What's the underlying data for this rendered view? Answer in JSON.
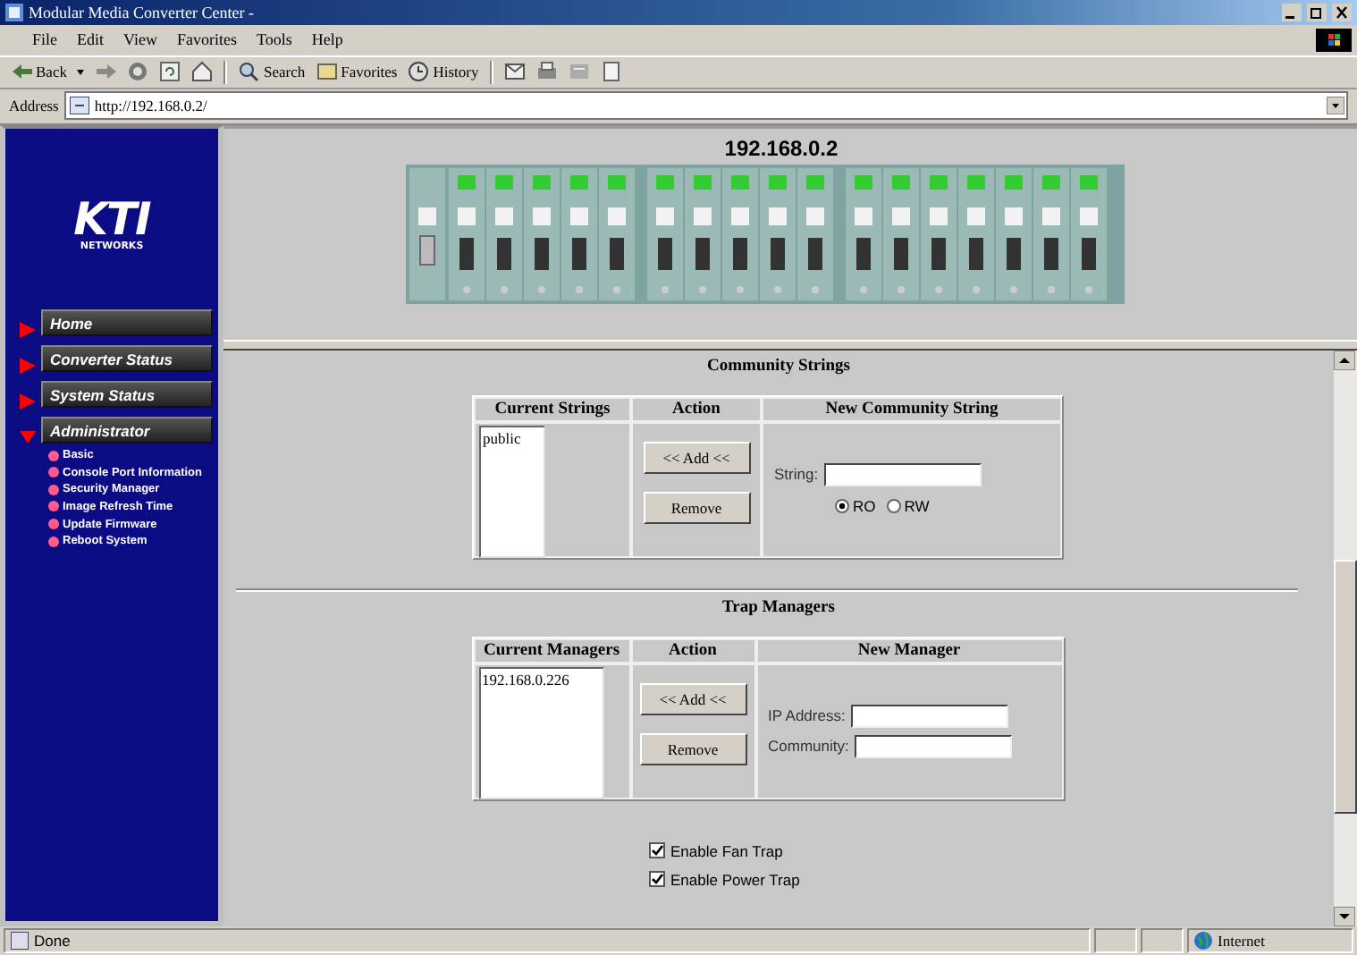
{
  "window": {
    "title": "Modular Media Converter Center -"
  },
  "menu": [
    {
      "label": "File"
    },
    {
      "label": "Edit"
    },
    {
      "label": "View"
    },
    {
      "label": "Favorites"
    },
    {
      "label": "Tools"
    },
    {
      "label": "Help"
    }
  ],
  "toolbar": [
    {
      "kind": "back",
      "label": "Back"
    },
    {
      "kind": "forward"
    },
    {
      "kind": "stop"
    },
    {
      "kind": "refresh"
    },
    {
      "kind": "home"
    },
    {
      "kind": "search",
      "label": "Search"
    },
    {
      "kind": "favorites",
      "label": "Favorites"
    },
    {
      "kind": "history",
      "label": "History"
    },
    {
      "kind": "mail"
    },
    {
      "kind": "print"
    },
    {
      "kind": "edit"
    },
    {
      "kind": "discuss"
    }
  ],
  "address": {
    "label": "Address",
    "value": "http://192.168.0.2/"
  },
  "sidebar": {
    "logo": {
      "name": "KTI",
      "tagline": "NETWORKS"
    },
    "items": [
      {
        "label": "Home",
        "expanded": false
      },
      {
        "label": "Converter Status",
        "expanded": false
      },
      {
        "label": "System Status",
        "expanded": false
      },
      {
        "label": "Administrator",
        "expanded": true,
        "children": [
          {
            "label": "Basic"
          },
          {
            "label": "Console Port Information"
          },
          {
            "label": "Security Manager"
          },
          {
            "label": "Image Refresh Time"
          },
          {
            "label": "Update Firmware"
          },
          {
            "label": "Reboot System"
          }
        ]
      }
    ]
  },
  "device": {
    "title": "192.168.0.2"
  },
  "community": {
    "title": "Community Strings",
    "columns": [
      "Current Strings",
      "Action",
      "New Community String"
    ],
    "current": [
      "public"
    ],
    "buttons": [
      "<< Add <<",
      "Remove"
    ],
    "fields": [
      {
        "label": "String:"
      }
    ],
    "radios": [
      {
        "label": "RO",
        "selected": true
      },
      {
        "label": "RW",
        "selected": false
      }
    ]
  },
  "trap": {
    "title": "Trap Managers",
    "columns": [
      "Current Managers",
      "Action",
      "New Manager"
    ],
    "current": [
      "192.168.0.226"
    ],
    "buttons": [
      "<< Add <<",
      "Remove"
    ],
    "fields": [
      {
        "label": "IP Address:"
      },
      {
        "label": "Community:"
      }
    ]
  },
  "options": [
    {
      "label": "Enable Fan Trap",
      "checked": true
    },
    {
      "label": "Enable Power Trap",
      "checked": true
    }
  ],
  "status_bar": {
    "text": "Done",
    "zone": "Internet"
  }
}
